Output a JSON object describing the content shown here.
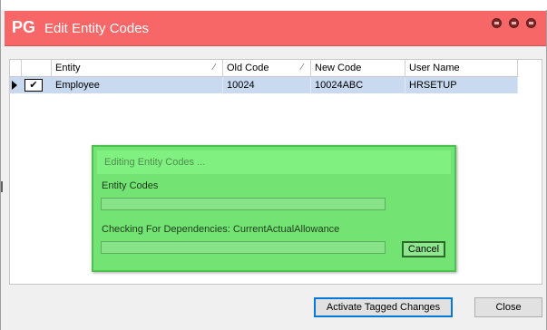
{
  "window": {
    "logo": "PG",
    "title": "Edit Entity Codes",
    "accent_color": "#f86767"
  },
  "grid": {
    "columns": [
      {
        "label": "Entity",
        "sort_icon": "sort-icon"
      },
      {
        "label": "Old Code",
        "sort_icon": "sort-icon"
      },
      {
        "label": "New Code"
      },
      {
        "label": "User Name"
      }
    ],
    "rows": [
      {
        "tagged": "✔",
        "entity": "Employee",
        "old_code": "10024",
        "new_code": "10024ABC",
        "user_name": "HRSETUP"
      }
    ]
  },
  "progress_dialog": {
    "title": "Editing Entity Codes ...",
    "task1_label": "Entity Codes",
    "task1_progress": 0,
    "task2_label": "Checking For Dependencies: CurrentActualAllowance",
    "task2_progress": 0,
    "cancel_label": "Cancel",
    "color": "#73e473"
  },
  "footer": {
    "activate_label": "Activate Tagged Changes",
    "close_label": "Close"
  }
}
